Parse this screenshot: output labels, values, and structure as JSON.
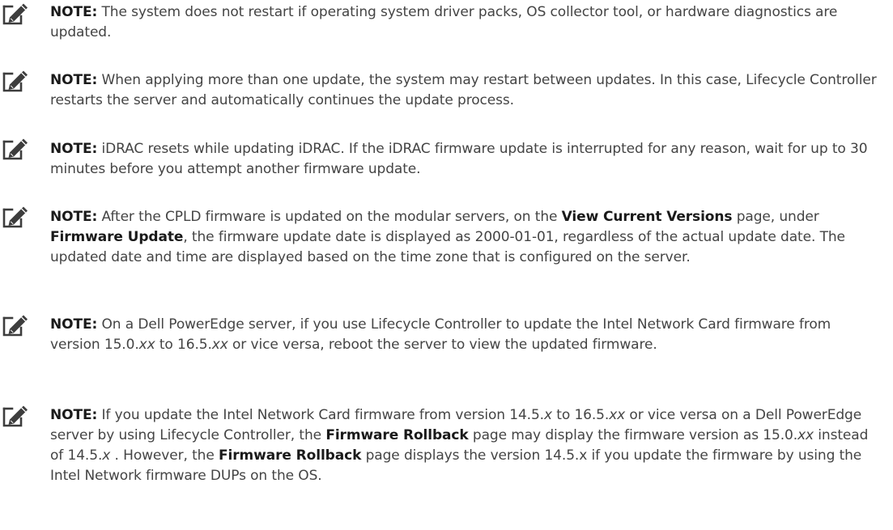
{
  "note_label": "NOTE:",
  "notes": [
    {
      "segments": [
        {
          "text": "The system does not restart if operating system driver packs, OS collector tool, or hardware diagnostics are updated.",
          "style": "normal"
        }
      ]
    },
    {
      "segments": [
        {
          "text": "When applying more than one update, the system may restart between updates. In this case, Lifecycle Controller restarts the server and automatically continues the update process.",
          "style": "normal"
        }
      ]
    },
    {
      "segments": [
        {
          "text": "iDRAC resets while updating iDRAC. If the iDRAC firmware update is interrupted for any reason, wait for up to 30 minutes before you attempt another firmware update.",
          "style": "normal"
        }
      ]
    },
    {
      "segments": [
        {
          "text": "After the CPLD firmware is updated on the modular servers, on the ",
          "style": "normal"
        },
        {
          "text": "View Current Versions",
          "style": "bold"
        },
        {
          "text": " page, under ",
          "style": "normal"
        },
        {
          "text": "Firmware Update",
          "style": "bold"
        },
        {
          "text": ", the firmware update date is displayed as 2000-01-01, regardless of the actual update date. The updated date and time are displayed based on the time zone that is configured on the server.",
          "style": "normal"
        }
      ]
    },
    {
      "segments": [
        {
          "text": "On a Dell PowerEdge server, if you use Lifecycle Controller to update the Intel Network Card firmware from version 15.0.",
          "style": "normal"
        },
        {
          "text": "xx",
          "style": "italic"
        },
        {
          "text": " to 16.5.",
          "style": "normal"
        },
        {
          "text": "xx",
          "style": "italic"
        },
        {
          "text": " or vice versa, reboot the server to view the updated firmware.",
          "style": "normal"
        }
      ]
    },
    {
      "segments": [
        {
          "text": "If you update the Intel Network Card firmware from version 14.5.",
          "style": "normal"
        },
        {
          "text": "x",
          "style": "italic"
        },
        {
          "text": " to 16.5.",
          "style": "normal"
        },
        {
          "text": "xx",
          "style": "italic"
        },
        {
          "text": " or vice versa on a Dell PowerEdge server by using Lifecycle Controller, the ",
          "style": "normal"
        },
        {
          "text": "Firmware Rollback",
          "style": "bold"
        },
        {
          "text": " page may display the firmware version as 15.0.",
          "style": "normal"
        },
        {
          "text": "xx",
          "style": "italic"
        },
        {
          "text": " instead of 14.5.",
          "style": "normal"
        },
        {
          "text": "x",
          "style": "italic"
        },
        {
          "text": " . However, the ",
          "style": "normal"
        },
        {
          "text": "Firmware Rollback",
          "style": "bold"
        },
        {
          "text": " page displays the version 14.5.x if you update the firmware by using the Intel Network firmware DUPs on the OS.",
          "style": "normal"
        }
      ]
    }
  ]
}
